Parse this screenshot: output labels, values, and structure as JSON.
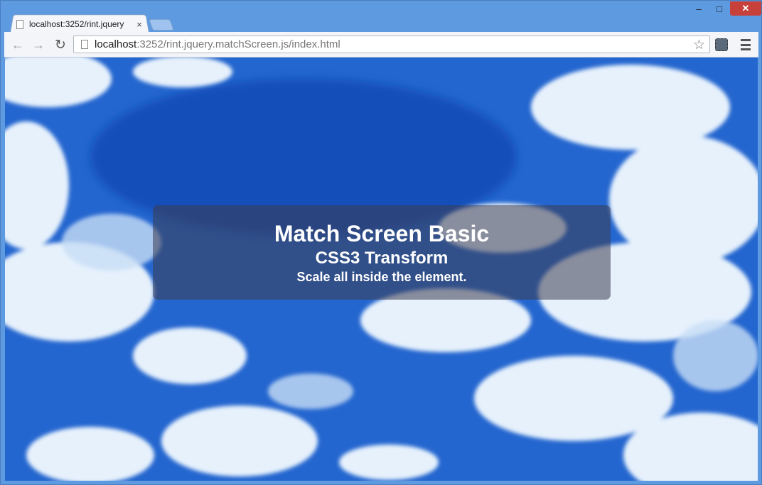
{
  "browser": {
    "tab_title": "localhost:3252/rint.jquery",
    "tab_close": "×",
    "url_host": "localhost",
    "url_rest": ":3252/rint.jquery.matchScreen.js/index.html",
    "window_min": "–",
    "window_max": "□",
    "window_close": "✕",
    "back": "←",
    "forward": "→",
    "reload": "↻",
    "star": "☆"
  },
  "page": {
    "title": "Match Screen Basic",
    "subtitle": "CSS3 Transform",
    "description": "Scale all inside the element."
  },
  "colors": {
    "sky": "#2a6fd6",
    "cloud": "#e8f2fc",
    "panel": "#3c3c50"
  }
}
